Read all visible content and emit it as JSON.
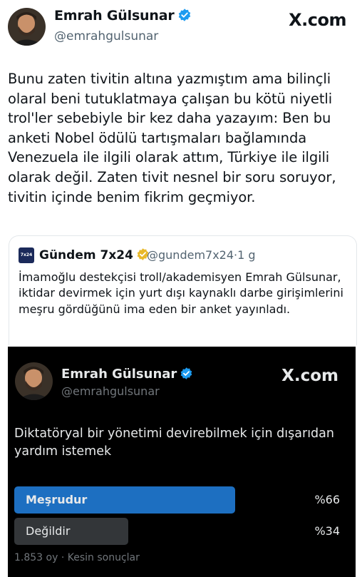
{
  "tweet": {
    "author_name": "Emrah Gülsunar",
    "author_handle": "@emrahgulsunar",
    "site": "X.com",
    "text": "Bunu zaten tivitin altına yazmıştım ama bilinçli olaral beni tutuklatmaya çalışan bu kötü niyetli trol'ler sebebiyle bir kez daha yazayım: Ben bu anketi Nobel ödülü tartışmaları bağlamında Venezuela ile ilgili olarak attım, Türkiye ile ilgili olarak değil. Zaten tivit nesnel bir soru soruyor, tivitin içinde benim fikrim geçmiyor."
  },
  "quote": {
    "account_name": "Gündem 7x24",
    "account_handle": "@gundem7x24",
    "separator": "·",
    "time": "1 g",
    "logo_text": "7x24",
    "text": "İmamoğlu destekçisi troll/akademisyen Emrah Gülsunar, iktidar devirmek için yurt dışı kaynaklı darbe girişimlerini meşru gördüğünü ima eden bir anket yayınladı."
  },
  "poll_image": {
    "author_name": "Emrah Gülsunar",
    "author_handle": "@emrahgulsunar",
    "site": "X.com",
    "question": "Diktatöryal bir yönetimi devirebilmek için dışarıdan yardım istemek",
    "options": [
      {
        "label": "Meşrudur",
        "percent": "%66",
        "fraction": 0.66,
        "winner": true
      },
      {
        "label": "Değildir",
        "percent": "%34",
        "fraction": 0.34,
        "winner": false
      }
    ],
    "footer": "1.853 oy · Kesin sonuçlar"
  },
  "colors": {
    "verified_blue": "#1d9bf0",
    "verified_gold": "#e8b829",
    "winner_bar": "#1d6fc1",
    "loser_bar": "#333639"
  }
}
